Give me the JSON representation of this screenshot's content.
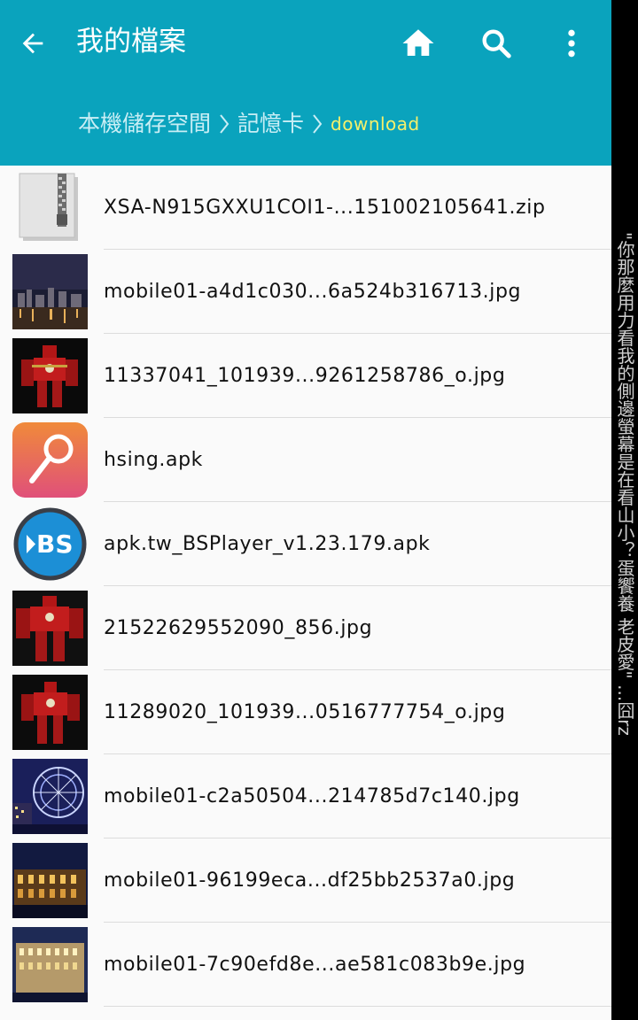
{
  "appbar": {
    "title": "我的檔案",
    "icons": [
      "back-arrow-icon",
      "home-icon",
      "search-icon",
      "more-vert-icon"
    ]
  },
  "breadcrumb": {
    "items": [
      "本機儲存空間",
      "記憶卡",
      "download"
    ]
  },
  "files": [
    {
      "name": "XSA-N915GXXU1COI1-...151002105641.zip",
      "thumb": "zip-icon"
    },
    {
      "name": "mobile01-a4d1c030...6a524b316713.jpg",
      "thumb": "night-city-photo"
    },
    {
      "name": "11337041_101939...9261258786_o.jpg",
      "thumb": "red-robot-photo"
    },
    {
      "name": "hsing.apk",
      "thumb": "hsing-app-icon"
    },
    {
      "name": "apk.tw_BSPlayer_v1.23.179.apk",
      "thumb": "bsplayer-app-icon"
    },
    {
      "name": "21522629552090_856.jpg",
      "thumb": "red-robot-photo"
    },
    {
      "name": "11289020_101939...0516777754_o.jpg",
      "thumb": "red-robot-photo"
    },
    {
      "name": "mobile01-c2a50504...214785d7c140.jpg",
      "thumb": "ferris-wheel-photo"
    },
    {
      "name": "mobile01-96199eca...df25bb2537a0.jpg",
      "thumb": "lit-building-photo"
    },
    {
      "name": "mobile01-7c90efd8e...ae581c083b9e.jpg",
      "thumb": "lit-building-photo"
    }
  ],
  "side_caption": "\"你那麼用力看我的側邊螢幕是在看山小？蛋饗養 老皮愛\" ...囧rz",
  "colors": {
    "accent": "#0aa3bd",
    "crumb_active": "#f6f06a"
  }
}
